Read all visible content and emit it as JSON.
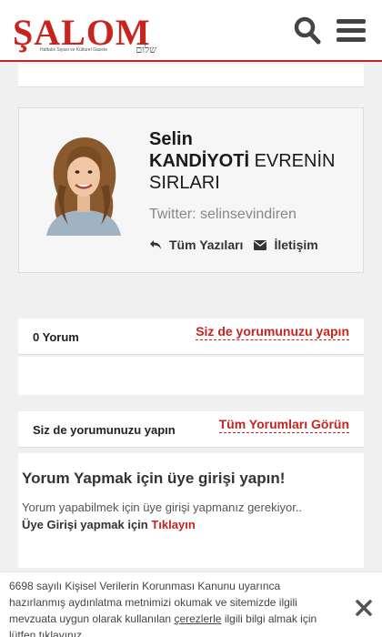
{
  "header": {
    "logo_text": "ŞALOM",
    "logo_hebrew": "שלום",
    "logo_tagline": "Haftalık Siyasi ve Kültürel Gazete"
  },
  "author": {
    "first_name": "Selin",
    "last_name": "KANDİYOTİ",
    "column_title": "EVRENİN SIRLARI",
    "twitter": "Twitter: selinsevindiren",
    "all_posts_label": "Tüm Yazıları",
    "contact_label": "İletişim"
  },
  "comments_bar": {
    "count_label": "0 Yorum",
    "write_label": "Siz de yorumunuzu yapın"
  },
  "comment_tabs": {
    "left_label": "Siz de yorumunuzu yapın",
    "see_all_label": "Tüm Yorumları Görün"
  },
  "login": {
    "title": "Yorum Yapmak için üye girişi yapın!",
    "text": "Yorum yapabilmek için üye girişi yapmanız gerekiyor..",
    "link_prefix": "Üye Girişi yapmak için ",
    "link_label": "Tıklayın"
  },
  "cookie": {
    "text_before": "6698 sayılı Kişisel Verilerin Korunması Kanunu uyarınca hazırlanmış aydınlatma metnimizi okumak ve sitemizde ilgili mevzuata uygun olarak kullanılan ",
    "link_label": "çerezlerle",
    "text_after": " ilgili bilgi almak için lütfen tıklayınız."
  },
  "colors": {
    "brand_red": "#c9231f",
    "icon_dark": "#444444"
  },
  "icons": {
    "search": "search-icon",
    "menu": "hamburger-menu-icon",
    "reply": "reply-arrow-icon",
    "mail": "envelope-icon",
    "close": "close-icon"
  }
}
